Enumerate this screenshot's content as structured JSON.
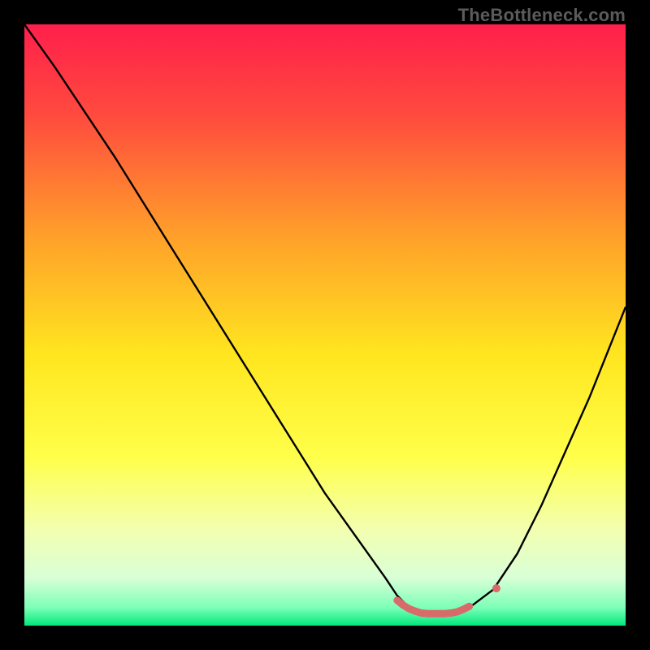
{
  "watermark": "TheBottleneck.com",
  "chart_data": {
    "type": "line",
    "title": "",
    "xlabel": "",
    "ylabel": "",
    "xlim": [
      0,
      100
    ],
    "ylim": [
      0,
      100
    ],
    "grid": false,
    "legend": false,
    "background_gradient": {
      "stops": [
        {
          "offset": 0.0,
          "color": "#ff1f4b"
        },
        {
          "offset": 0.15,
          "color": "#ff4a3e"
        },
        {
          "offset": 0.35,
          "color": "#ff9f2a"
        },
        {
          "offset": 0.55,
          "color": "#ffe61f"
        },
        {
          "offset": 0.72,
          "color": "#ffff4a"
        },
        {
          "offset": 0.84,
          "color": "#f3ffb0"
        },
        {
          "offset": 0.92,
          "color": "#d9ffd6"
        },
        {
          "offset": 0.97,
          "color": "#7dffb8"
        },
        {
          "offset": 1.0,
          "color": "#00e87a"
        }
      ]
    },
    "series": [
      {
        "name": "bottleneck-curve",
        "stroke": "#000000",
        "stroke_width": 2.4,
        "x": [
          0,
          5,
          10,
          15,
          20,
          25,
          30,
          35,
          40,
          45,
          50,
          55,
          60,
          62,
          64,
          67,
          70,
          72,
          74,
          78,
          82,
          86,
          90,
          94,
          98,
          100
        ],
        "y": [
          100,
          93,
          85.5,
          78,
          70,
          62,
          54,
          46,
          38,
          30,
          22,
          15,
          8,
          5,
          3,
          2,
          2,
          2,
          3,
          6,
          12,
          20,
          29,
          38,
          48,
          53
        ]
      }
    ],
    "marker_segment": {
      "name": "optimal-range",
      "stroke": "#d96a6a",
      "stroke_width": 9,
      "linecap": "round",
      "x": [
        62,
        63,
        64,
        65,
        66,
        67,
        68,
        69,
        70,
        71,
        72,
        73,
        74
      ],
      "y": [
        4.2,
        3.4,
        2.8,
        2.4,
        2.1,
        2.0,
        2.0,
        2.0,
        2.0,
        2.1,
        2.3,
        2.7,
        3.2
      ]
    },
    "marker_dot": {
      "name": "optimal-point",
      "fill": "#d96a6a",
      "x": 78.5,
      "y": 6.2,
      "r": 5
    }
  }
}
